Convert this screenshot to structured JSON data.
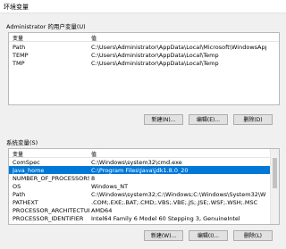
{
  "window": {
    "title": "环境变量"
  },
  "user_vars": {
    "label": "Administrator 的用户变量(U)",
    "col_name": "变量",
    "col_value": "值",
    "rows": [
      {
        "name": "Path",
        "value": "C:\\Users\\Administrator\\AppData\\Local\\Microsoft\\WindowsApps;"
      },
      {
        "name": "TEMP",
        "value": "C:\\Users\\Administrator\\AppData\\Local\\Temp"
      },
      {
        "name": "TMP",
        "value": "C:\\Users\\Administrator\\AppData\\Local\\Temp"
      }
    ],
    "buttons": {
      "new": "新建(N)...",
      "edit": "编辑(E)...",
      "delete": "删除(D)"
    }
  },
  "system_vars": {
    "label": "系统变量(S)",
    "col_name": "变量",
    "col_value": "值",
    "rows": [
      {
        "name": "ComSpec",
        "value": "C:\\Windows\\system32\\cmd.exe",
        "selected": false
      },
      {
        "name": "Java_home",
        "value": "C:\\Program Files\\Java\\jdk1.8.0_20",
        "selected": true
      },
      {
        "name": "NUMBER_OF_PROCESSORS",
        "value": "8",
        "selected": false
      },
      {
        "name": "OS",
        "value": "Windows_NT",
        "selected": false
      },
      {
        "name": "Path",
        "value": "C:\\Windows\\system32;C:\\Windows;C:\\Windows\\System32\\Wbem;...",
        "selected": false
      },
      {
        "name": "PATHEXT",
        "value": ".COM;.EXE;.BAT;.CMD;.VBS;.VBE;.JS;.JSE;.WSF;.WSH;.MSC",
        "selected": false
      },
      {
        "name": "PROCESSOR_ARCHITECTURE",
        "value": "AMD64",
        "selected": false
      },
      {
        "name": "PROCESSOR_IDENTIFIER",
        "value": "Intel64 Family 6 Model 60 Stepping 3, GenuineIntel",
        "selected": false
      }
    ],
    "buttons": {
      "new": "新建(W)...",
      "edit": "编辑(I)...",
      "delete": "删除(L)"
    }
  }
}
